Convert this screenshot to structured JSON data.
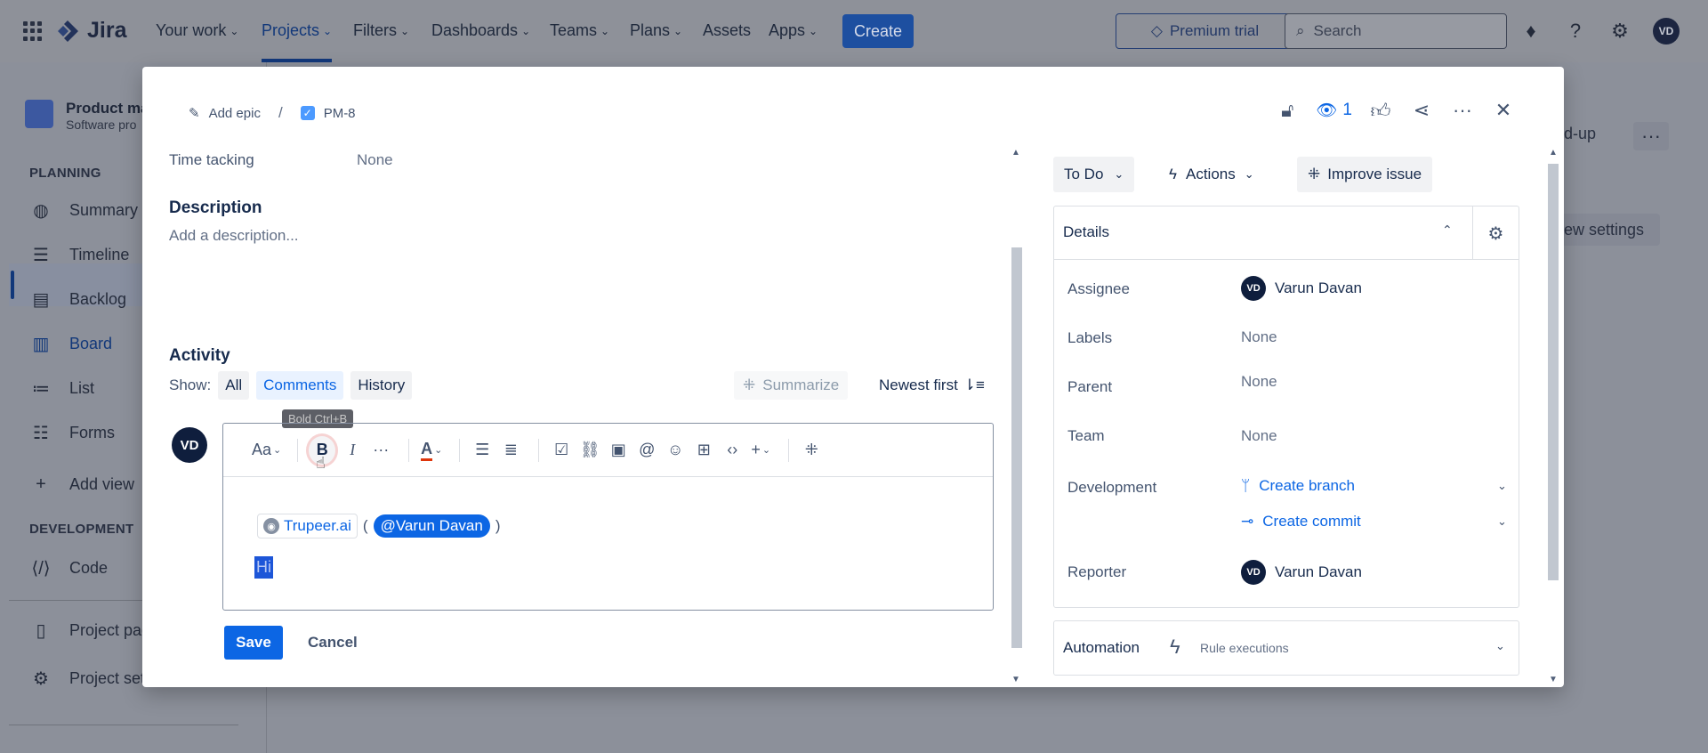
{
  "topnav": {
    "logo_text": "Jira",
    "items": [
      {
        "label": "Your work"
      },
      {
        "label": "Projects"
      },
      {
        "label": "Filters"
      },
      {
        "label": "Dashboards"
      },
      {
        "label": "Teams"
      },
      {
        "label": "Plans"
      },
      {
        "label": "Assets"
      },
      {
        "label": "Apps"
      }
    ],
    "create_label": "Create",
    "premium_label": "Premium trial",
    "search_placeholder": "Search",
    "avatar_initials": "VD"
  },
  "sidebar": {
    "project_name": "Product ma",
    "project_type": "Software pro",
    "planning_label": "PLANNING",
    "planning_items": [
      {
        "label": "Summary",
        "icon": "globe-icon"
      },
      {
        "label": "Timeline",
        "icon": "timeline-icon"
      },
      {
        "label": "Backlog",
        "icon": "backlog-icon"
      },
      {
        "label": "Board",
        "icon": "board-icon"
      },
      {
        "label": "List",
        "icon": "list-icon"
      },
      {
        "label": "Forms",
        "icon": "forms-icon"
      }
    ],
    "add_view_label": "Add view",
    "development_label": "DEVELOPMENT",
    "code_label": "Code",
    "project_pages_label": "Project pag",
    "project_settings_label": "Project sett"
  },
  "background_right": {
    "standup_text": "nd-up",
    "settings_text": "iew settings"
  },
  "modal": {
    "breadcrumb": {
      "add_epic": "Add epic",
      "separator": "/",
      "issue_key": "PM-8"
    },
    "watch_count": "1",
    "time_tracking_label": "Time tacking",
    "time_tracking_value": "None",
    "description_heading": "Description",
    "description_placeholder": "Add a description...",
    "activity_heading": "Activity",
    "show_label": "Show:",
    "filters": [
      {
        "label": "All"
      },
      {
        "label": "Comments"
      },
      {
        "label": "History"
      }
    ],
    "summarize_label": "Summarize",
    "sort_label": "Newest first",
    "commenter_initials": "VD",
    "tooltip": "Bold Ctrl+B",
    "editor": {
      "text_style_label": "Aa",
      "bold_label": "B",
      "italic_label": "I",
      "more_label": "···",
      "color_label": "A",
      "chip_label": "Trupeer.ai",
      "paren_open": "(",
      "mention_label": "@Varun Davan",
      "paren_close": ")",
      "selected_text": "Hi"
    },
    "save_label": "Save",
    "cancel_label": "Cancel",
    "status_label": "To Do",
    "actions_label": "Actions",
    "improve_label": "Improve issue",
    "details": {
      "title": "Details",
      "assignee_label": "Assignee",
      "assignee_initials": "VD",
      "assignee_name": "Varun Davan",
      "labels_label": "Labels",
      "labels_value": "None",
      "parent_label": "Parent",
      "parent_value": "None",
      "team_label": "Team",
      "team_value": "None",
      "development_label": "Development",
      "create_branch": "Create branch",
      "create_commit": "Create commit",
      "reporter_label": "Reporter",
      "reporter_initials": "VD",
      "reporter_name": "Varun Davan"
    },
    "automation": {
      "title": "Automation",
      "subtitle": "Rule executions"
    }
  },
  "colors": {
    "brand_blue": "#0c66e4",
    "overlay": "#8c909a"
  }
}
